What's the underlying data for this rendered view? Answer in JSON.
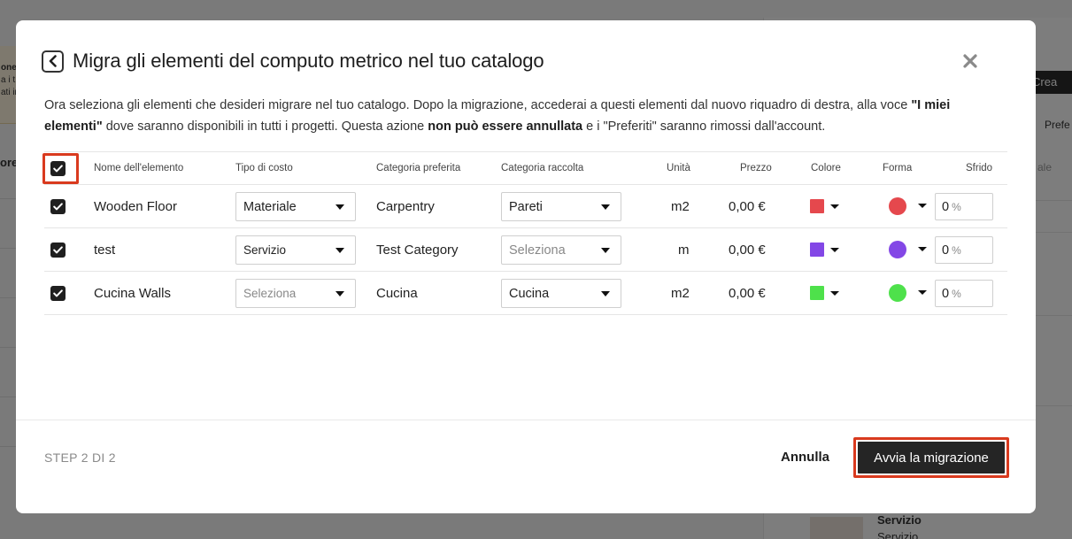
{
  "background": {
    "left_banner_lines": [
      "one",
      "a i t",
      "ati ir"
    ],
    "left_label": "ore",
    "create_button": "Crea",
    "right_labels": [
      "Prefe",
      "ale"
    ],
    "bottom_item_title": "Servizio",
    "bottom_item_subtitle": "Servizio"
  },
  "modal": {
    "title": "Migra gli elementi del computo metrico nel tuo catalogo",
    "description": {
      "part1": "Ora seleziona gli elementi che desideri migrare nel tuo catalogo. Dopo la migrazione, accederai a questi elementi dal nuovo riquadro di destra, alla voce ",
      "bold1": "\"I miei elementi\"",
      "part2": " dove saranno disponibili in tutti i progetti. Questa azione ",
      "bold2": "non può essere annullata",
      "part3": " e i \"Preferiti\" saranno rimossi dall'account."
    },
    "table": {
      "headers": {
        "name": "Nome dell'elemento",
        "cost_type": "Tipo di costo",
        "preferred_category": "Categoria preferita",
        "collection_category": "Categoria raccolta",
        "unit": "Unità",
        "price": "Prezzo",
        "color": "Colore",
        "shape": "Forma",
        "waste": "Sfrido"
      },
      "rows": [
        {
          "name": "Wooden Floor",
          "cost_type": "Materiale",
          "preferred_category": "Carpentry",
          "collection_category": "Pareti",
          "unit": "m2",
          "price": "0,00 €",
          "color": "#e5484d",
          "waste": "0",
          "waste_unit": "%"
        },
        {
          "name": "test",
          "cost_type": "Servizio",
          "preferred_category": "Test Category",
          "collection_category": "Seleziona",
          "unit": "m",
          "price": "0,00 €",
          "color": "#8347e6",
          "waste": "0",
          "waste_unit": "%"
        },
        {
          "name": "Cucina Walls",
          "cost_type": "Seleziona",
          "preferred_category": "Cucina",
          "collection_category": "Cucina",
          "unit": "m2",
          "price": "0,00 €",
          "color": "#4ee14b",
          "waste": "0",
          "waste_unit": "%"
        }
      ]
    },
    "footer": {
      "step": "STEP 2 DI 2",
      "cancel": "Annulla",
      "start": "Avvia la migrazione"
    },
    "colors": {
      "highlight": "#d93a1e",
      "primary": "#252525"
    }
  }
}
